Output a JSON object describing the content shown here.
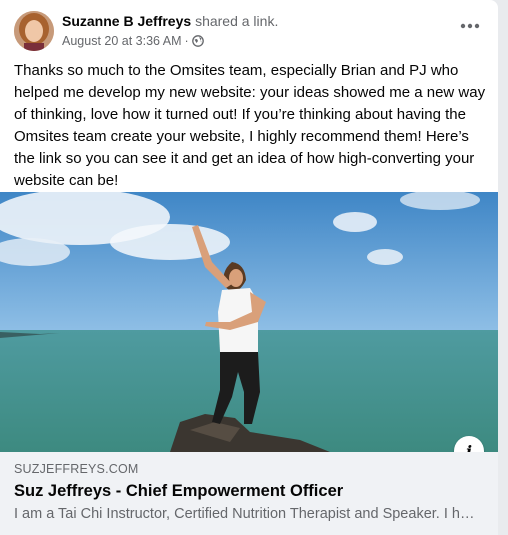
{
  "post": {
    "author": "Suzanne B Jeffreys",
    "action": "shared a link.",
    "timestamp": "August 20 at 3:36 AM",
    "separator": "·",
    "privacy_icon": "globe-icon",
    "more_icon": "more-options-icon",
    "text": "Thanks so much to the Omsites team, especially Brian and PJ who helped me develop my new website: your ideas showed me a new way of thinking, love how it turned out! If you’re thinking about having the Omsites team create your website, I highly recommend them! Here’s the link so you can see it and get an idea of how high-converting your website can be!"
  },
  "link": {
    "domain": "SUZJEFFREYS.COM",
    "title": "Suz Jeffreys - Chief Empowerment Officer",
    "description": "I am a Tai Chi Instructor, Certified Nutrition Therapist and Speaker. I help women",
    "info_label": "i"
  },
  "colors": {
    "text_primary": "#050505",
    "text_secondary": "#65676b",
    "card_background": "#f0f2f5",
    "page_background": "#e9ebee"
  }
}
